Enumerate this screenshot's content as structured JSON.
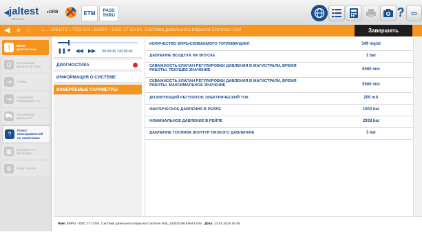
{
  "app": {
    "logo": "jaltest",
    "logo_sub": "TRUCKS"
  },
  "toolbar": {
    "grb_label": "GRB",
    "etm_label": "ETM",
    "pass_label_1": "PASS",
    "pass_label_2": "THRU"
  },
  "breadcrumb": {
    "text": "1... \\ DEUTZ \\ TCD 3.6 \\ EMR4 - EDC 17 CV54, Система дизельного впрыска Common Rail",
    "finish_label": "Завершить"
  },
  "sidebar": {
    "items": [
      {
        "label_1": "Меню",
        "label_2": "диагностики",
        "label_3": "",
        "state": "active"
      },
      {
        "label_1": "Технические",
        "label_2": "данные системы",
        "label_3": "",
        "state": "disabled"
      },
      {
        "label_1": "Схемы",
        "label_2": "",
        "label_3": "",
        "state": "disabled"
      },
      {
        "label_1": "Служебная",
        "label_2": "информация ТС",
        "label_3": "",
        "state": "disabled"
      },
      {
        "label_1": "Технические",
        "label_2": "данные ТС",
        "label_3": "",
        "state": "disabled"
      },
      {
        "label_1": "Поиск",
        "label_2": "неисправностей",
        "label_3": "по симптомам",
        "state": "selected"
      },
      {
        "label_1": "Документы и",
        "label_2": "процедуры",
        "label_3": "",
        "state": "disabled"
      },
      {
        "label_1": "Коды ошибок",
        "label_2": "",
        "label_3": "",
        "state": "disabled"
      }
    ]
  },
  "player": {
    "time": "00:00:06 / 00:00:42",
    "progress": 0.14
  },
  "nav": {
    "diagnostics": "ДИАГНОСТИКА",
    "system_info": "ИНФОРМАЦИЯ О СИСТЕМЕ",
    "measured_params": "ИЗМЕРЯЕМЫЕ ПАРАМЕТРЫ"
  },
  "params": [
    {
      "name": "КОЛИЧЕСТВО ВПРЫСКИВАЕМОГО ТОПЛИВА/ЦИКЛ",
      "name2": "",
      "value": "349 mg/st"
    },
    {
      "name": "ДАВЛЕНИЕ ВОЗДУХА НА ВПУСКЕ",
      "name2": "",
      "value": "1 bar"
    },
    {
      "name": "СКВАЖНОСТЬ КЛАПАН РЕГУЛИРОВКИ ДАВЛЕНИЯ В МАГИСТРАЛИ, ВРЕМЯ",
      "name2": "РАБОТЫ, ТЕКУЩЕЕ ЗНАЧЕНИЕ",
      "value": "5000 min"
    },
    {
      "name": "СКВАЖНОСТЬ КЛАПАН РЕГУЛИРОВКИ ДАВЛЕНИЯ В МАГИСТРАЛИ, ВРЕМЯ",
      "name2": "РАБОТЫ, МАКСИМАЛЬНОЕ ЗНАЧЕНИЕ",
      "value": "5500 min"
    },
    {
      "name": "ДОЗИРУЮЩИЙ РЕГУЛЯТОР, ЭЛЕКТРИЧЕСКИЙ ТОК",
      "name2": "",
      "value": "200 mA"
    },
    {
      "name": "ФАКТИЧЕСКОЕ ДАВЛЕНИЯ В РЕЙЛЕ",
      "name2": "",
      "value": "1003 bar"
    },
    {
      "name": "НОМИНАЛЬНОЕ ДАВЛЕНИЕ В РЕЙЛЕ",
      "name2": "",
      "value": "2928 bar"
    },
    {
      "name": "ДАВЛЕНИЕ ТОПЛИВА (КОНТУР НИЗКОГО ДАВЛЕНИЯ)",
      "name2": "",
      "value": "3 bar"
    }
  ],
  "footer": {
    "name_label": "Имя:",
    "name_value": "EMR4 - EDC 17 CV54, Система дизельного впрыска Common Rail_13032019164644.scbi",
    "date_label": "Дата:",
    "date_value": "13.03.2019 16:46"
  },
  "colors": {
    "accent": "#f7941d",
    "brand": "#1c4f8f",
    "alert": "#e0262d"
  }
}
